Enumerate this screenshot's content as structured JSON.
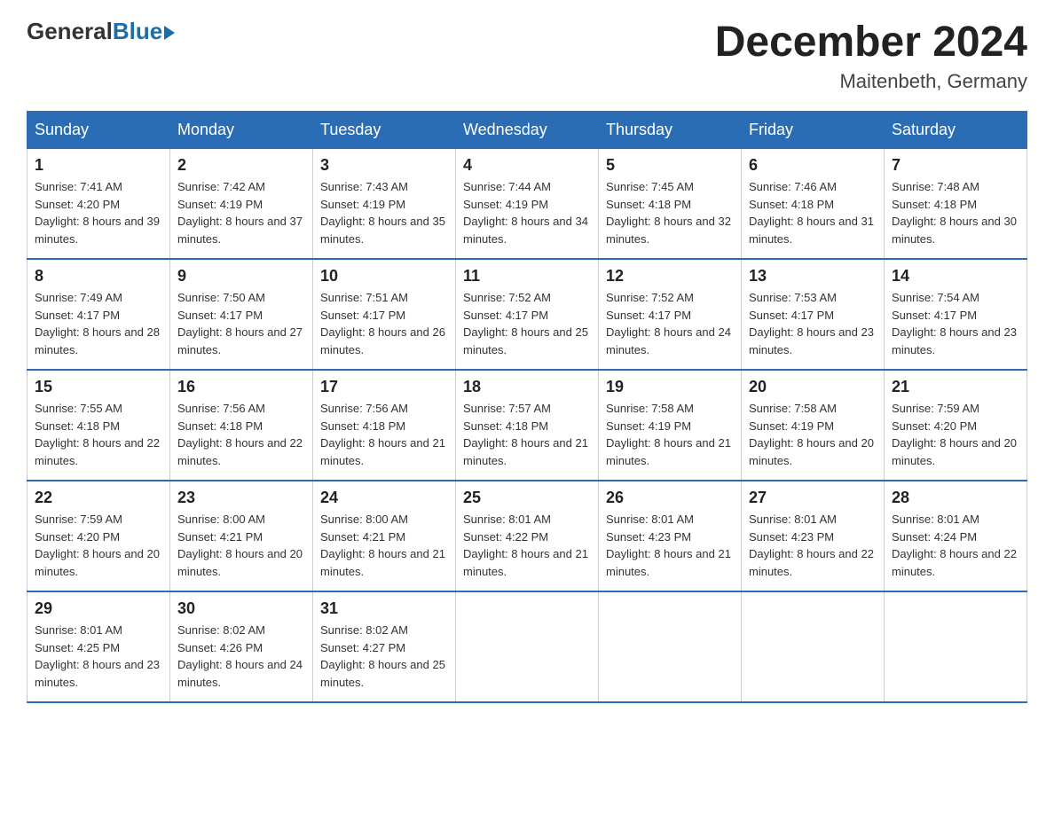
{
  "logo": {
    "general": "General",
    "blue": "Blue"
  },
  "title": "December 2024",
  "subtitle": "Maitenbeth, Germany",
  "headers": [
    "Sunday",
    "Monday",
    "Tuesday",
    "Wednesday",
    "Thursday",
    "Friday",
    "Saturday"
  ],
  "weeks": [
    [
      {
        "day": "1",
        "sunrise": "7:41 AM",
        "sunset": "4:20 PM",
        "daylight": "8 hours and 39 minutes."
      },
      {
        "day": "2",
        "sunrise": "7:42 AM",
        "sunset": "4:19 PM",
        "daylight": "8 hours and 37 minutes."
      },
      {
        "day": "3",
        "sunrise": "7:43 AM",
        "sunset": "4:19 PM",
        "daylight": "8 hours and 35 minutes."
      },
      {
        "day": "4",
        "sunrise": "7:44 AM",
        "sunset": "4:19 PM",
        "daylight": "8 hours and 34 minutes."
      },
      {
        "day": "5",
        "sunrise": "7:45 AM",
        "sunset": "4:18 PM",
        "daylight": "8 hours and 32 minutes."
      },
      {
        "day": "6",
        "sunrise": "7:46 AM",
        "sunset": "4:18 PM",
        "daylight": "8 hours and 31 minutes."
      },
      {
        "day": "7",
        "sunrise": "7:48 AM",
        "sunset": "4:18 PM",
        "daylight": "8 hours and 30 minutes."
      }
    ],
    [
      {
        "day": "8",
        "sunrise": "7:49 AM",
        "sunset": "4:17 PM",
        "daylight": "8 hours and 28 minutes."
      },
      {
        "day": "9",
        "sunrise": "7:50 AM",
        "sunset": "4:17 PM",
        "daylight": "8 hours and 27 minutes."
      },
      {
        "day": "10",
        "sunrise": "7:51 AM",
        "sunset": "4:17 PM",
        "daylight": "8 hours and 26 minutes."
      },
      {
        "day": "11",
        "sunrise": "7:52 AM",
        "sunset": "4:17 PM",
        "daylight": "8 hours and 25 minutes."
      },
      {
        "day": "12",
        "sunrise": "7:52 AM",
        "sunset": "4:17 PM",
        "daylight": "8 hours and 24 minutes."
      },
      {
        "day": "13",
        "sunrise": "7:53 AM",
        "sunset": "4:17 PM",
        "daylight": "8 hours and 23 minutes."
      },
      {
        "day": "14",
        "sunrise": "7:54 AM",
        "sunset": "4:17 PM",
        "daylight": "8 hours and 23 minutes."
      }
    ],
    [
      {
        "day": "15",
        "sunrise": "7:55 AM",
        "sunset": "4:18 PM",
        "daylight": "8 hours and 22 minutes."
      },
      {
        "day": "16",
        "sunrise": "7:56 AM",
        "sunset": "4:18 PM",
        "daylight": "8 hours and 22 minutes."
      },
      {
        "day": "17",
        "sunrise": "7:56 AM",
        "sunset": "4:18 PM",
        "daylight": "8 hours and 21 minutes."
      },
      {
        "day": "18",
        "sunrise": "7:57 AM",
        "sunset": "4:18 PM",
        "daylight": "8 hours and 21 minutes."
      },
      {
        "day": "19",
        "sunrise": "7:58 AM",
        "sunset": "4:19 PM",
        "daylight": "8 hours and 21 minutes."
      },
      {
        "day": "20",
        "sunrise": "7:58 AM",
        "sunset": "4:19 PM",
        "daylight": "8 hours and 20 minutes."
      },
      {
        "day": "21",
        "sunrise": "7:59 AM",
        "sunset": "4:20 PM",
        "daylight": "8 hours and 20 minutes."
      }
    ],
    [
      {
        "day": "22",
        "sunrise": "7:59 AM",
        "sunset": "4:20 PM",
        "daylight": "8 hours and 20 minutes."
      },
      {
        "day": "23",
        "sunrise": "8:00 AM",
        "sunset": "4:21 PM",
        "daylight": "8 hours and 20 minutes."
      },
      {
        "day": "24",
        "sunrise": "8:00 AM",
        "sunset": "4:21 PM",
        "daylight": "8 hours and 21 minutes."
      },
      {
        "day": "25",
        "sunrise": "8:01 AM",
        "sunset": "4:22 PM",
        "daylight": "8 hours and 21 minutes."
      },
      {
        "day": "26",
        "sunrise": "8:01 AM",
        "sunset": "4:23 PM",
        "daylight": "8 hours and 21 minutes."
      },
      {
        "day": "27",
        "sunrise": "8:01 AM",
        "sunset": "4:23 PM",
        "daylight": "8 hours and 22 minutes."
      },
      {
        "day": "28",
        "sunrise": "8:01 AM",
        "sunset": "4:24 PM",
        "daylight": "8 hours and 22 minutes."
      }
    ],
    [
      {
        "day": "29",
        "sunrise": "8:01 AM",
        "sunset": "4:25 PM",
        "daylight": "8 hours and 23 minutes."
      },
      {
        "day": "30",
        "sunrise": "8:02 AM",
        "sunset": "4:26 PM",
        "daylight": "8 hours and 24 minutes."
      },
      {
        "day": "31",
        "sunrise": "8:02 AM",
        "sunset": "4:27 PM",
        "daylight": "8 hours and 25 minutes."
      },
      null,
      null,
      null,
      null
    ]
  ]
}
